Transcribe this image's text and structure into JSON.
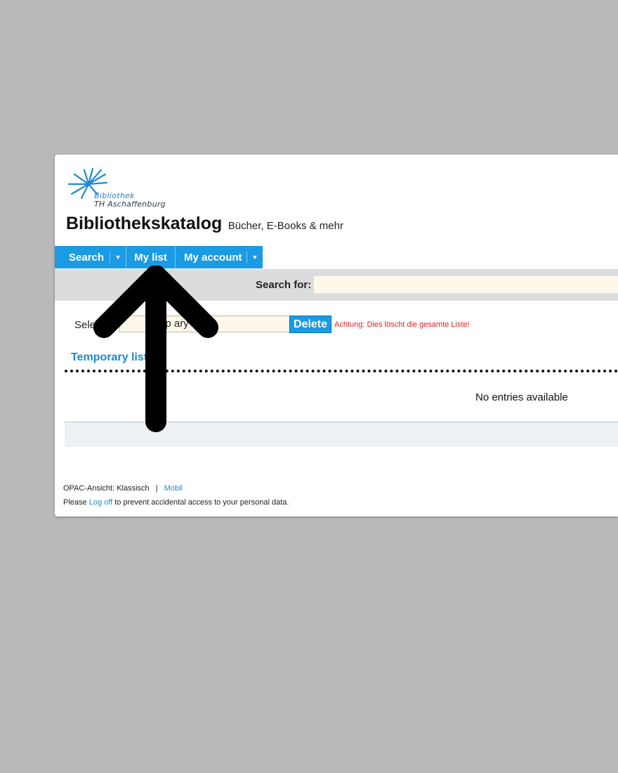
{
  "logo": {
    "line1": "Bibliothek",
    "line2": "TH Aschaffenburg"
  },
  "header": {
    "title": "Bibliothekskatalog",
    "subtitle": "Bücher, E-Books & mehr"
  },
  "nav": {
    "items": [
      {
        "label": "Search",
        "has_dropdown": true
      },
      {
        "label": "My list",
        "has_dropdown": false
      },
      {
        "label": "My account",
        "has_dropdown": true
      }
    ]
  },
  "search": {
    "label": "Search for:",
    "value": ""
  },
  "list_select": {
    "label": "Sele",
    "selected_value": "Temp    ary l",
    "delete_label": "Delete",
    "warning": "Achtung: Dies löscht die gesamte Liste!"
  },
  "list": {
    "heading": "Temporary list",
    "empty_text": "No entries available"
  },
  "footer": {
    "view_label": "OPAC-Ansicht:",
    "view_current": "Klassisch",
    "separator": "|",
    "view_mobile": "Mobil",
    "logoff_prefix": "Please",
    "logoff_link": "Log off",
    "logoff_suffix": "to prevent accidental access to your personal data."
  },
  "colors": {
    "background": "#b9b9b9",
    "nav_blue": "#1a9be3",
    "link_blue": "#1d89cf",
    "warning_red": "#e02020",
    "search_bar": "#dcdcdc",
    "input_bg": "#fdf8e9"
  }
}
